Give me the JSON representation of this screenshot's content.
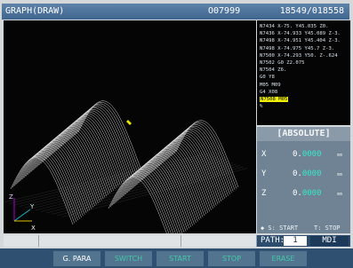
{
  "title_bar": {
    "screen_name": "GRAPH(DRAW)",
    "program_number": "O07999",
    "counter": "18549/018558"
  },
  "program_lines": [
    "N7434 X-75. Y45.035 Z0.",
    "N7436 X-74.933 Y45.089 Z-3.",
    "N7498 X-74.951 Y45.404 Z-3.",
    "N7498 X-74.975 Y45.7 Z-3.",
    "N7500 X-74.293 Y50. Z-.624",
    "N7502 G0 Z2.075",
    "N7504 Z6.",
    "G0 Y8",
    "M05 M09",
    "G4 X08",
    "N7508 M05",
    "%"
  ],
  "highlighted_line_index": 10,
  "absolute": {
    "title": "[ABSOLUTE]",
    "axes": [
      {
        "name": "X",
        "lead": "0.",
        "value": "0000",
        "unit": "mm"
      },
      {
        "name": "Y",
        "lead": "0.",
        "value": "0000",
        "unit": "mm"
      },
      {
        "name": "Z",
        "lead": "0.",
        "value": "0000",
        "unit": "mm"
      }
    ]
  },
  "start_hints": {
    "s_start": "◆ S: START",
    "t_stop": "T: STOP"
  },
  "path": {
    "label": "PATH:",
    "value": "1",
    "mode": "MDI"
  },
  "axis_triad": {
    "z": "Z",
    "y": "Y",
    "x": "X"
  },
  "function_keys": [
    {
      "label": "G. PARA",
      "active": true
    },
    {
      "label": "SWITCH",
      "active": false
    },
    {
      "label": "START",
      "active": false
    },
    {
      "label": "STOP",
      "active": false
    },
    {
      "label": "ERASE",
      "active": false
    }
  ],
  "colors": {
    "title_bar": "#4a7098",
    "toolpath": "#f2f2f2",
    "highlight": "#f2f200",
    "value_text": "#36e6c8",
    "panel": "#6f8394",
    "function_key": "#52748f"
  }
}
